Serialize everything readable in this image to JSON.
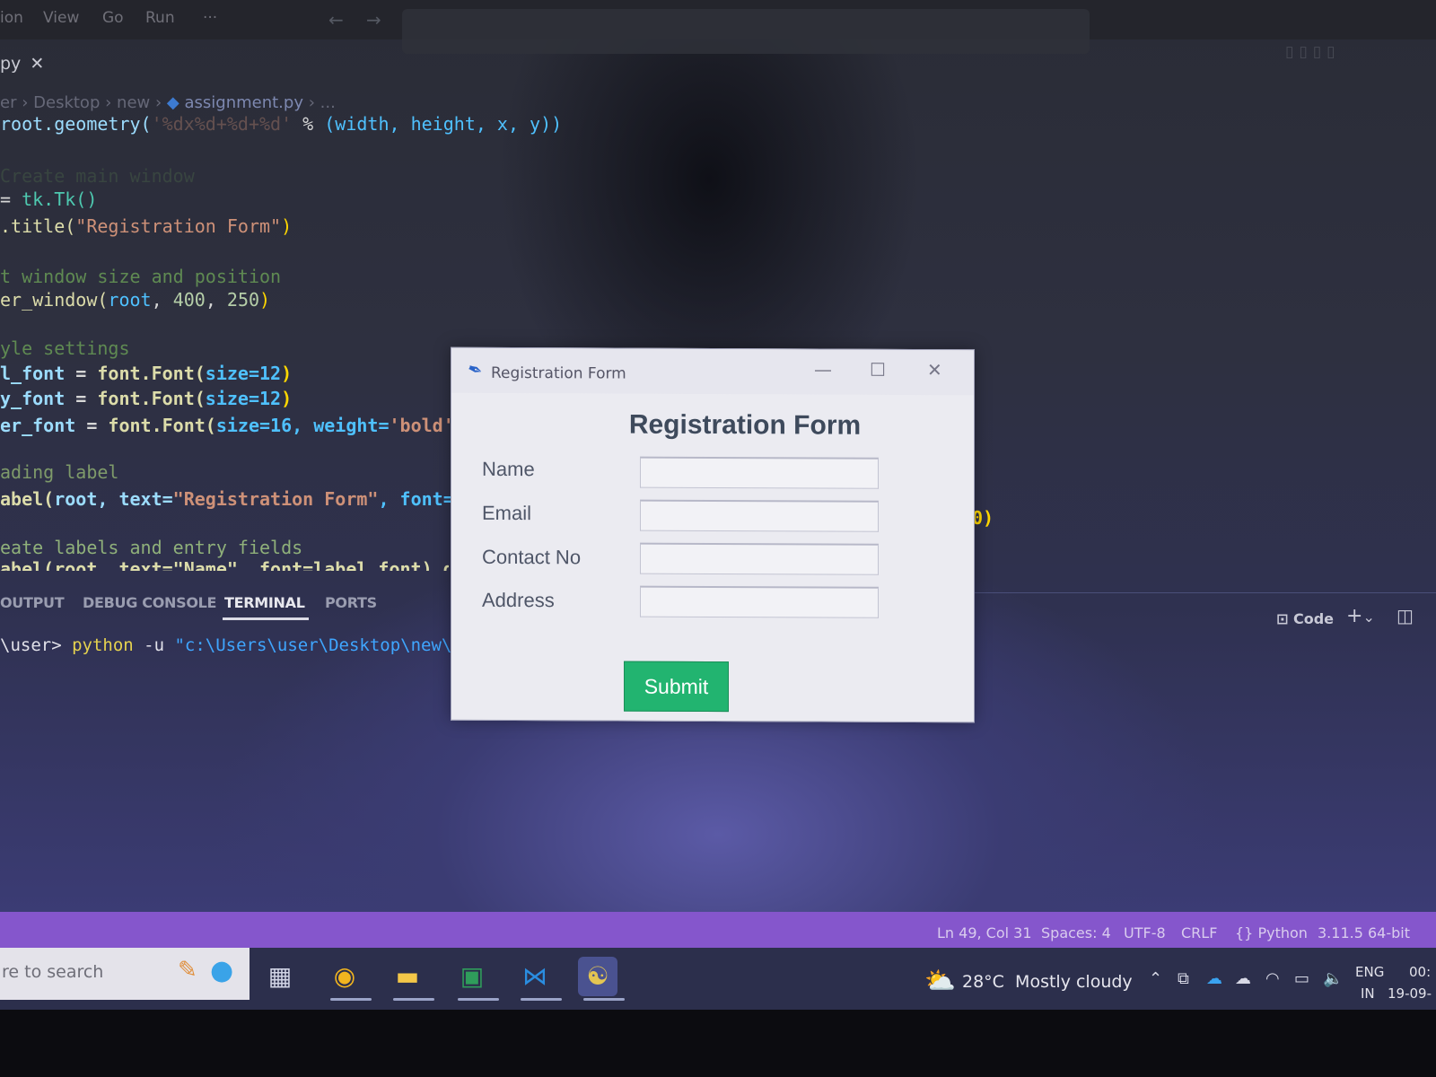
{
  "menubar": {
    "items": [
      "ion",
      "View",
      "Go",
      "Run",
      "···"
    ]
  },
  "editor": {
    "tab_label": "py",
    "breadcrumb": [
      "er",
      "Desktop",
      "new",
      "assignment.py",
      "..."
    ],
    "code_lines": {
      "l1": {
        "a": "root.geometry(",
        "b": "'%dx%d+%d+%d'",
        "c": " % ",
        "d": "(width, height, x, y))"
      },
      "l2": {
        "a": "Create main window"
      },
      "l3": {
        "a": "= ",
        "b": "tk.Tk()"
      },
      "l4": {
        "a": ".title(",
        "b": "\"Registration Form\"",
        "c": ")"
      },
      "l5": {
        "a": "t window size and position"
      },
      "l6": {
        "a": "er_window(",
        "b": "root",
        "c": ", ",
        "d": "400",
        "e": ", ",
        "f": "250",
        "g": ")"
      },
      "l7": {
        "a": "yle settings"
      },
      "l8": {
        "a": "l_font",
        "b": " = ",
        "c": "font.Font(",
        "d": "size=12",
        "e": ")"
      },
      "l9": {
        "a": "y_font",
        "b": " = ",
        "c": "font.Font(",
        "d": "size=12",
        "e": ")"
      },
      "l10": {
        "a": "er_font",
        "b": " = ",
        "c": "font.Font(",
        "d": "size=16, ",
        "e": "weight=",
        "f": "'bold'",
        "g": ")"
      },
      "l11": {
        "a": "ading label"
      },
      "l12": {
        "a": "abel(",
        "b": "root, text=",
        "c": "\"Registration Form\"",
        "d": ", font=hea"
      },
      "l13": {
        "a": "eate labels and entry fields"
      },
      "l14": {
        "a": "abel(root, text=\"Name\", font=label_font).grid("
      },
      "stray_right": "0)"
    }
  },
  "panel": {
    "tabs": [
      "OUTPUT",
      "DEBUG CONSOLE",
      "TERMINAL",
      "PORTS"
    ],
    "active_tab": "TERMINAL",
    "terminal_prompt": "\\user> ",
    "terminal_cmd": "python",
    "terminal_flag": " -u ",
    "terminal_path": "\"c:\\Users\\user\\Desktop\\new\\assig",
    "right_controls": {
      "code_label": "Code",
      "plus": "+",
      "chevron": "⌄",
      "split": "◫"
    }
  },
  "dialog": {
    "window_title": "Registration Form",
    "heading": "Registration Form",
    "fields": [
      {
        "label": "Name",
        "value": ""
      },
      {
        "label": "Email",
        "value": ""
      },
      {
        "label": "Contact No",
        "value": ""
      },
      {
        "label": "Address",
        "value": ""
      }
    ],
    "submit_label": "Submit",
    "submit_color": "#22b470"
  },
  "statusbar": {
    "position": "Ln 49, Col 31",
    "spaces": "Spaces: 4",
    "encoding": "UTF-8",
    "eol": "CRLF",
    "language": "Python",
    "interpreter": "3.11.5 64-bit",
    "color": "#8556cc"
  },
  "taskbar": {
    "search_placeholder": "re to search",
    "weather_temp": "28°C",
    "weather_desc": "Mostly cloudy",
    "lang_top": "ENG",
    "lang_bottom": "IN",
    "time": "00:",
    "date": "19-09-"
  }
}
